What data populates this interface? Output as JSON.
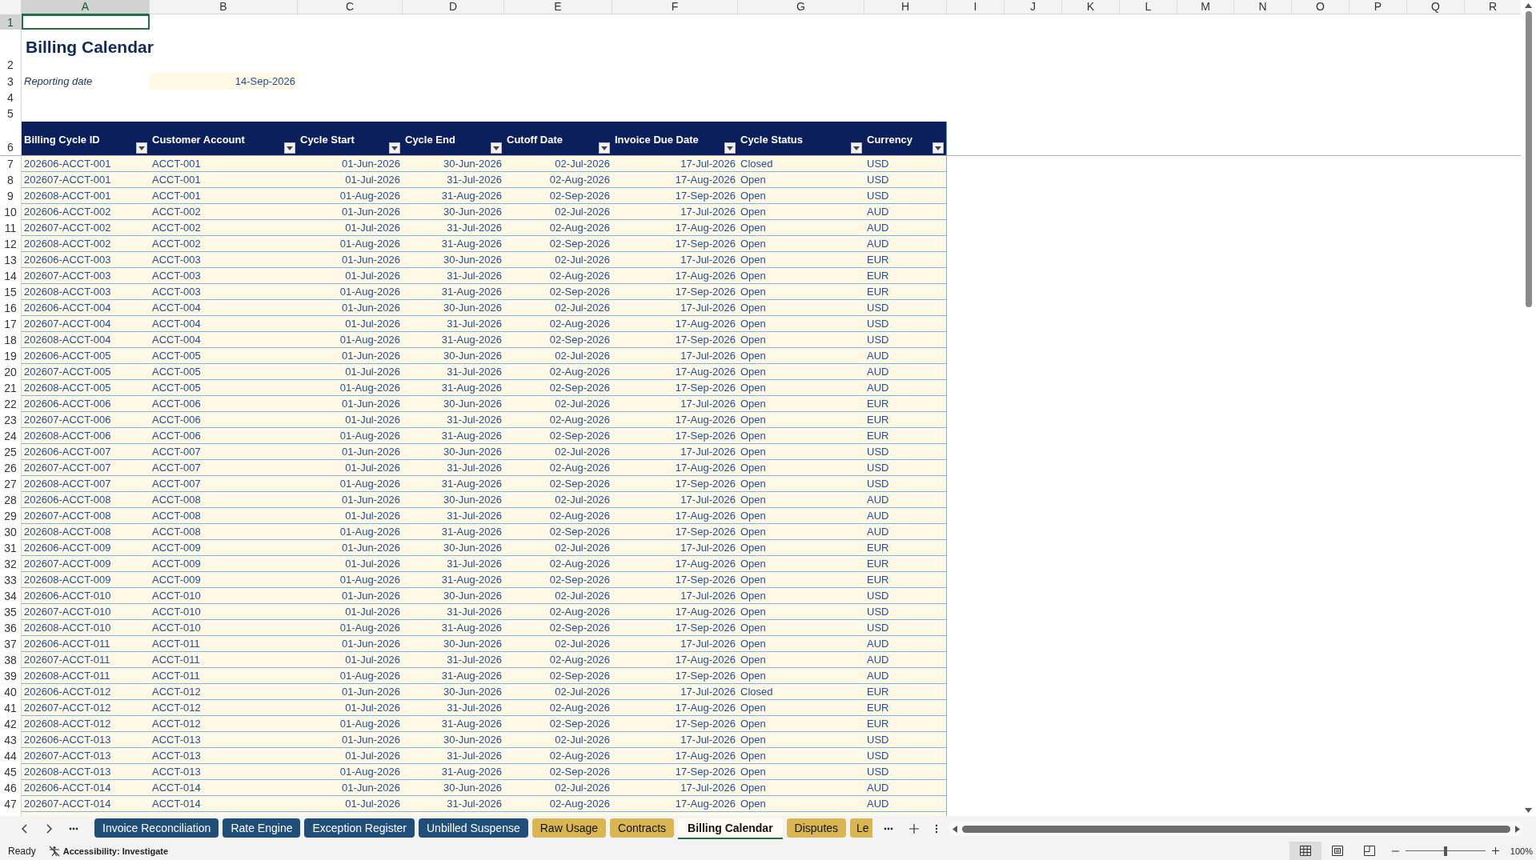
{
  "columns": [
    {
      "label": "A",
      "selected": true
    },
    {
      "label": "B",
      "selected": false
    },
    {
      "label": "C",
      "selected": false
    },
    {
      "label": "D",
      "selected": false
    },
    {
      "label": "E",
      "selected": false
    },
    {
      "label": "F",
      "selected": false
    },
    {
      "label": "G",
      "selected": false
    },
    {
      "label": "H",
      "selected": false
    },
    {
      "label": "I",
      "selected": false
    },
    {
      "label": "J",
      "selected": false
    },
    {
      "label": "K",
      "selected": false
    },
    {
      "label": "L",
      "selected": false
    },
    {
      "label": "M",
      "selected": false
    },
    {
      "label": "N",
      "selected": false
    },
    {
      "label": "O",
      "selected": false
    },
    {
      "label": "P",
      "selected": false
    },
    {
      "label": "Q",
      "selected": false
    },
    {
      "label": "R",
      "selected": false
    }
  ],
  "row_headers": [
    {
      "label": "1",
      "selected": true
    },
    {
      "label": "2",
      "selected": false
    },
    {
      "label": "3",
      "selected": false
    },
    {
      "label": "4",
      "selected": false
    },
    {
      "label": "5",
      "selected": false
    },
    {
      "label": "6",
      "selected": false
    },
    {
      "label": "7",
      "selected": false
    },
    {
      "label": "8",
      "selected": false
    },
    {
      "label": "9",
      "selected": false
    },
    {
      "label": "10",
      "selected": false
    },
    {
      "label": "11",
      "selected": false
    },
    {
      "label": "12",
      "selected": false
    },
    {
      "label": "13",
      "selected": false
    },
    {
      "label": "14",
      "selected": false
    },
    {
      "label": "15",
      "selected": false
    },
    {
      "label": "16",
      "selected": false
    },
    {
      "label": "17",
      "selected": false
    },
    {
      "label": "18",
      "selected": false
    },
    {
      "label": "19",
      "selected": false
    },
    {
      "label": "20",
      "selected": false
    },
    {
      "label": "21",
      "selected": false
    },
    {
      "label": "22",
      "selected": false
    },
    {
      "label": "23",
      "selected": false
    },
    {
      "label": "24",
      "selected": false
    },
    {
      "label": "25",
      "selected": false
    },
    {
      "label": "26",
      "selected": false
    },
    {
      "label": "27",
      "selected": false
    },
    {
      "label": "28",
      "selected": false
    },
    {
      "label": "29",
      "selected": false
    },
    {
      "label": "30",
      "selected": false
    },
    {
      "label": "31",
      "selected": false
    },
    {
      "label": "32",
      "selected": false
    },
    {
      "label": "33",
      "selected": false
    },
    {
      "label": "34",
      "selected": false
    },
    {
      "label": "35",
      "selected": false
    },
    {
      "label": "36",
      "selected": false
    },
    {
      "label": "37",
      "selected": false
    },
    {
      "label": "38",
      "selected": false
    },
    {
      "label": "39",
      "selected": false
    },
    {
      "label": "40",
      "selected": false
    },
    {
      "label": "41",
      "selected": false
    },
    {
      "label": "42",
      "selected": false
    },
    {
      "label": "43",
      "selected": false
    },
    {
      "label": "44",
      "selected": false
    },
    {
      "label": "45",
      "selected": false
    },
    {
      "label": "46",
      "selected": false
    },
    {
      "label": "47",
      "selected": false
    }
  ],
  "title": "Billing Calendar",
  "reporting_date": {
    "label": "Reporting date",
    "value": "14-Sep-2026"
  },
  "table": {
    "columns": [
      {
        "label": "Billing Cycle ID"
      },
      {
        "label": "Customer Account"
      },
      {
        "label": "Cycle Start"
      },
      {
        "label": "Cycle End"
      },
      {
        "label": "Cutoff Date"
      },
      {
        "label": "Invoice Due Date"
      },
      {
        "label": "Cycle Status"
      },
      {
        "label": "Currency"
      }
    ],
    "rows": [
      [
        "202606-ACCT-001",
        "ACCT-001",
        "01-Jun-2026",
        "30-Jun-2026",
        "02-Jul-2026",
        "17-Jul-2026",
        "Closed",
        "USD"
      ],
      [
        "202607-ACCT-001",
        "ACCT-001",
        "01-Jul-2026",
        "31-Jul-2026",
        "02-Aug-2026",
        "17-Aug-2026",
        "Open",
        "USD"
      ],
      [
        "202608-ACCT-001",
        "ACCT-001",
        "01-Aug-2026",
        "31-Aug-2026",
        "02-Sep-2026",
        "17-Sep-2026",
        "Open",
        "USD"
      ],
      [
        "202606-ACCT-002",
        "ACCT-002",
        "01-Jun-2026",
        "30-Jun-2026",
        "02-Jul-2026",
        "17-Jul-2026",
        "Open",
        "AUD"
      ],
      [
        "202607-ACCT-002",
        "ACCT-002",
        "01-Jul-2026",
        "31-Jul-2026",
        "02-Aug-2026",
        "17-Aug-2026",
        "Open",
        "AUD"
      ],
      [
        "202608-ACCT-002",
        "ACCT-002",
        "01-Aug-2026",
        "31-Aug-2026",
        "02-Sep-2026",
        "17-Sep-2026",
        "Open",
        "AUD"
      ],
      [
        "202606-ACCT-003",
        "ACCT-003",
        "01-Jun-2026",
        "30-Jun-2026",
        "02-Jul-2026",
        "17-Jul-2026",
        "Open",
        "EUR"
      ],
      [
        "202607-ACCT-003",
        "ACCT-003",
        "01-Jul-2026",
        "31-Jul-2026",
        "02-Aug-2026",
        "17-Aug-2026",
        "Open",
        "EUR"
      ],
      [
        "202608-ACCT-003",
        "ACCT-003",
        "01-Aug-2026",
        "31-Aug-2026",
        "02-Sep-2026",
        "17-Sep-2026",
        "Open",
        "EUR"
      ],
      [
        "202606-ACCT-004",
        "ACCT-004",
        "01-Jun-2026",
        "30-Jun-2026",
        "02-Jul-2026",
        "17-Jul-2026",
        "Open",
        "USD"
      ],
      [
        "202607-ACCT-004",
        "ACCT-004",
        "01-Jul-2026",
        "31-Jul-2026",
        "02-Aug-2026",
        "17-Aug-2026",
        "Open",
        "USD"
      ],
      [
        "202608-ACCT-004",
        "ACCT-004",
        "01-Aug-2026",
        "31-Aug-2026",
        "02-Sep-2026",
        "17-Sep-2026",
        "Open",
        "USD"
      ],
      [
        "202606-ACCT-005",
        "ACCT-005",
        "01-Jun-2026",
        "30-Jun-2026",
        "02-Jul-2026",
        "17-Jul-2026",
        "Open",
        "AUD"
      ],
      [
        "202607-ACCT-005",
        "ACCT-005",
        "01-Jul-2026",
        "31-Jul-2026",
        "02-Aug-2026",
        "17-Aug-2026",
        "Open",
        "AUD"
      ],
      [
        "202608-ACCT-005",
        "ACCT-005",
        "01-Aug-2026",
        "31-Aug-2026",
        "02-Sep-2026",
        "17-Sep-2026",
        "Open",
        "AUD"
      ],
      [
        "202606-ACCT-006",
        "ACCT-006",
        "01-Jun-2026",
        "30-Jun-2026",
        "02-Jul-2026",
        "17-Jul-2026",
        "Open",
        "EUR"
      ],
      [
        "202607-ACCT-006",
        "ACCT-006",
        "01-Jul-2026",
        "31-Jul-2026",
        "02-Aug-2026",
        "17-Aug-2026",
        "Open",
        "EUR"
      ],
      [
        "202608-ACCT-006",
        "ACCT-006",
        "01-Aug-2026",
        "31-Aug-2026",
        "02-Sep-2026",
        "17-Sep-2026",
        "Open",
        "EUR"
      ],
      [
        "202606-ACCT-007",
        "ACCT-007",
        "01-Jun-2026",
        "30-Jun-2026",
        "02-Jul-2026",
        "17-Jul-2026",
        "Open",
        "USD"
      ],
      [
        "202607-ACCT-007",
        "ACCT-007",
        "01-Jul-2026",
        "31-Jul-2026",
        "02-Aug-2026",
        "17-Aug-2026",
        "Open",
        "USD"
      ],
      [
        "202608-ACCT-007",
        "ACCT-007",
        "01-Aug-2026",
        "31-Aug-2026",
        "02-Sep-2026",
        "17-Sep-2026",
        "Open",
        "USD"
      ],
      [
        "202606-ACCT-008",
        "ACCT-008",
        "01-Jun-2026",
        "30-Jun-2026",
        "02-Jul-2026",
        "17-Jul-2026",
        "Open",
        "AUD"
      ],
      [
        "202607-ACCT-008",
        "ACCT-008",
        "01-Jul-2026",
        "31-Jul-2026",
        "02-Aug-2026",
        "17-Aug-2026",
        "Open",
        "AUD"
      ],
      [
        "202608-ACCT-008",
        "ACCT-008",
        "01-Aug-2026",
        "31-Aug-2026",
        "02-Sep-2026",
        "17-Sep-2026",
        "Open",
        "AUD"
      ],
      [
        "202606-ACCT-009",
        "ACCT-009",
        "01-Jun-2026",
        "30-Jun-2026",
        "02-Jul-2026",
        "17-Jul-2026",
        "Open",
        "EUR"
      ],
      [
        "202607-ACCT-009",
        "ACCT-009",
        "01-Jul-2026",
        "31-Jul-2026",
        "02-Aug-2026",
        "17-Aug-2026",
        "Open",
        "EUR"
      ],
      [
        "202608-ACCT-009",
        "ACCT-009",
        "01-Aug-2026",
        "31-Aug-2026",
        "02-Sep-2026",
        "17-Sep-2026",
        "Open",
        "EUR"
      ],
      [
        "202606-ACCT-010",
        "ACCT-010",
        "01-Jun-2026",
        "30-Jun-2026",
        "02-Jul-2026",
        "17-Jul-2026",
        "Open",
        "USD"
      ],
      [
        "202607-ACCT-010",
        "ACCT-010",
        "01-Jul-2026",
        "31-Jul-2026",
        "02-Aug-2026",
        "17-Aug-2026",
        "Open",
        "USD"
      ],
      [
        "202608-ACCT-010",
        "ACCT-010",
        "01-Aug-2026",
        "31-Aug-2026",
        "02-Sep-2026",
        "17-Sep-2026",
        "Open",
        "USD"
      ],
      [
        "202606-ACCT-011",
        "ACCT-011",
        "01-Jun-2026",
        "30-Jun-2026",
        "02-Jul-2026",
        "17-Jul-2026",
        "Open",
        "AUD"
      ],
      [
        "202607-ACCT-011",
        "ACCT-011",
        "01-Jul-2026",
        "31-Jul-2026",
        "02-Aug-2026",
        "17-Aug-2026",
        "Open",
        "AUD"
      ],
      [
        "202608-ACCT-011",
        "ACCT-011",
        "01-Aug-2026",
        "31-Aug-2026",
        "02-Sep-2026",
        "17-Sep-2026",
        "Open",
        "AUD"
      ],
      [
        "202606-ACCT-012",
        "ACCT-012",
        "01-Jun-2026",
        "30-Jun-2026",
        "02-Jul-2026",
        "17-Jul-2026",
        "Closed",
        "EUR"
      ],
      [
        "202607-ACCT-012",
        "ACCT-012",
        "01-Jul-2026",
        "31-Jul-2026",
        "02-Aug-2026",
        "17-Aug-2026",
        "Open",
        "EUR"
      ],
      [
        "202608-ACCT-012",
        "ACCT-012",
        "01-Aug-2026",
        "31-Aug-2026",
        "02-Sep-2026",
        "17-Sep-2026",
        "Open",
        "EUR"
      ],
      [
        "202606-ACCT-013",
        "ACCT-013",
        "01-Jun-2026",
        "30-Jun-2026",
        "02-Jul-2026",
        "17-Jul-2026",
        "Open",
        "USD"
      ],
      [
        "202607-ACCT-013",
        "ACCT-013",
        "01-Jul-2026",
        "31-Jul-2026",
        "02-Aug-2026",
        "17-Aug-2026",
        "Open",
        "USD"
      ],
      [
        "202608-ACCT-013",
        "ACCT-013",
        "01-Aug-2026",
        "31-Aug-2026",
        "02-Sep-2026",
        "17-Sep-2026",
        "Open",
        "USD"
      ],
      [
        "202606-ACCT-014",
        "ACCT-014",
        "01-Jun-2026",
        "30-Jun-2026",
        "02-Jul-2026",
        "17-Jul-2026",
        "Open",
        "AUD"
      ],
      [
        "202607-ACCT-014",
        "ACCT-014",
        "01-Jul-2026",
        "31-Jul-2026",
        "02-Aug-2026",
        "17-Aug-2026",
        "Open",
        "AUD"
      ]
    ]
  },
  "sheet_tabs": [
    {
      "label": "Invoice Reconciliation",
      "color": "#1f4e79",
      "selected": false
    },
    {
      "label": "Rate Engine",
      "color": "#1f4e79",
      "selected": false
    },
    {
      "label": "Exception Register",
      "color": "#1f4e79",
      "selected": false
    },
    {
      "label": "Unbilled Suspense",
      "color": "#1f4e79",
      "selected": false
    },
    {
      "label": "Raw Usage",
      "color": "#d9b650",
      "selected": false
    },
    {
      "label": "Contracts",
      "color": "#d9b650",
      "selected": false
    },
    {
      "label": "Billing Calendar",
      "selected": true
    },
    {
      "label": "Disputes",
      "color": "#d9b650",
      "selected": false
    },
    {
      "label": "Le",
      "color": "#d9b650",
      "selected": false
    }
  ],
  "status_bar": {
    "mode": "Ready",
    "accessibility": "Accessibility: Investigate",
    "view_buttons": [
      {
        "kind": "normal",
        "selected": true
      },
      {
        "kind": "page_layout",
        "selected": false
      },
      {
        "kind": "page_break",
        "selected": false
      }
    ],
    "zoom": {
      "level": 0.5,
      "reading": "100%"
    }
  }
}
